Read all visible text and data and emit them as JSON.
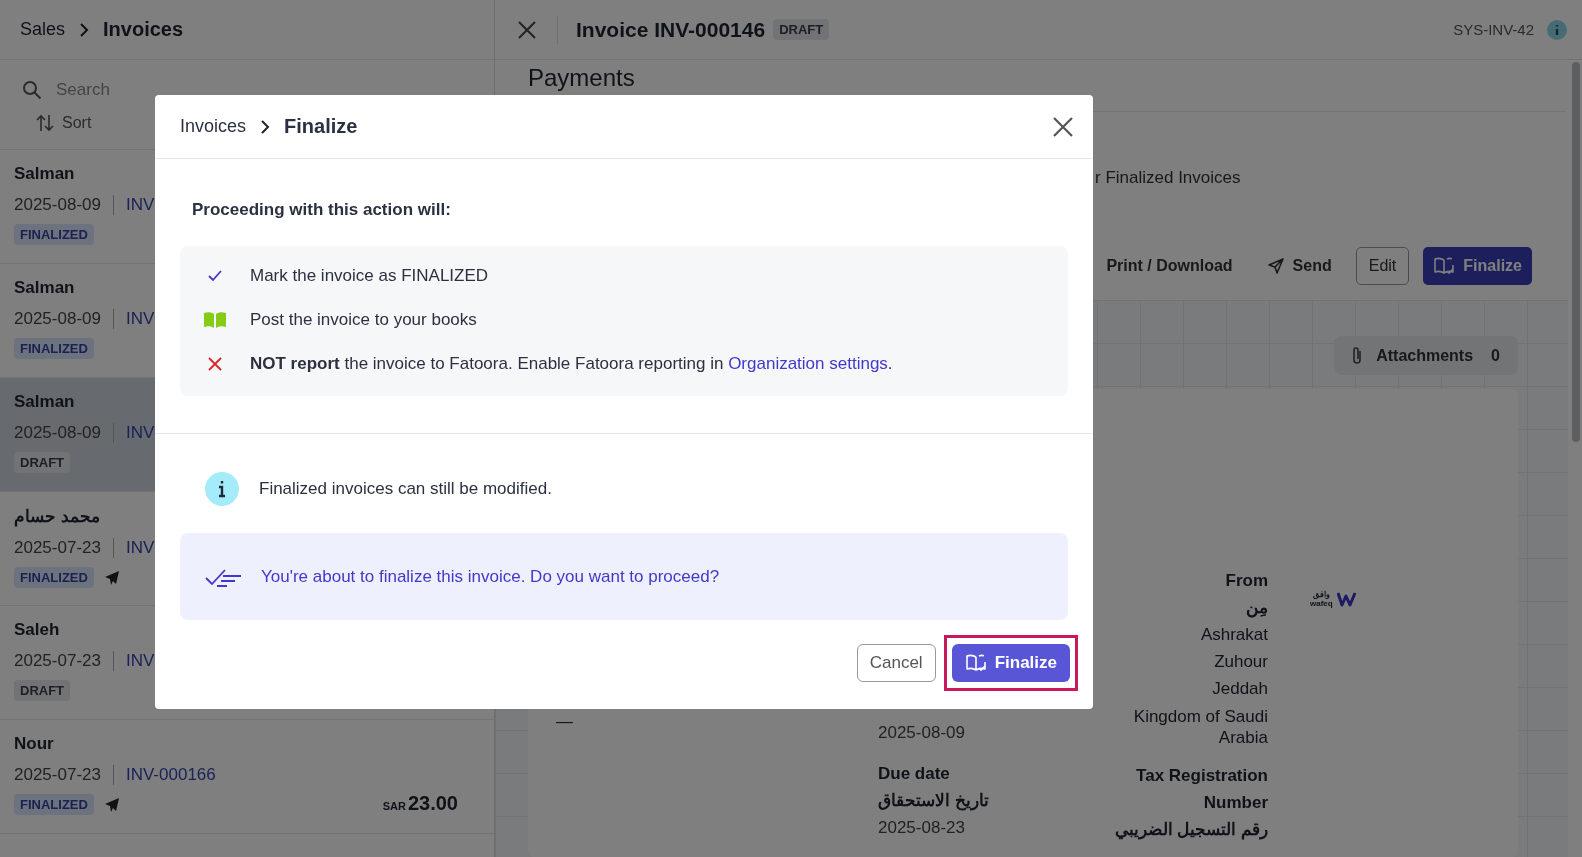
{
  "sidebar": {
    "breadcrumb": [
      "Sales",
      "Invoices"
    ],
    "search": {
      "placeholder": "Search"
    },
    "sort_label": "Sort",
    "invoices": [
      {
        "customer": "Salman",
        "date": "2025-08-09",
        "number": "INV",
        "status": "FINALIZED",
        "kind": "finalized",
        "sent": false,
        "selected": false
      },
      {
        "customer": "Salman",
        "date": "2025-08-09",
        "number": "INV",
        "status": "FINALIZED",
        "kind": "finalized",
        "sent": false,
        "selected": false
      },
      {
        "customer": "Salman",
        "date": "2025-08-09",
        "number": "INV",
        "status": "DRAFT",
        "kind": "draft",
        "sent": false,
        "selected": true
      },
      {
        "customer": "محمد حسام",
        "date": "2025-07-23",
        "number": "INV",
        "status": "FINALIZED",
        "kind": "finalized",
        "sent": true,
        "selected": false
      },
      {
        "customer": "Saleh",
        "date": "2025-07-23",
        "number": "INV",
        "status": "DRAFT",
        "kind": "draft",
        "sent": false,
        "selected": false
      },
      {
        "customer": "Nour",
        "date": "2025-07-23",
        "number": "INV-000166",
        "status": "FINALIZED",
        "kind": "finalized",
        "sent": true,
        "selected": false,
        "currency": "SAR",
        "amount": "23.00"
      }
    ]
  },
  "detail": {
    "title": "Invoice INV-000146",
    "status": {
      "label": "DRAFT",
      "kind": "draft"
    },
    "system_id": "SYS-INV-42",
    "section": "Payments",
    "note": "r Finalized Invoices",
    "actions": [
      {
        "kind": "print",
        "label": "Print / Download"
      },
      {
        "kind": "send",
        "label": "Send"
      },
      {
        "kind": "edit",
        "label": "Edit"
      },
      {
        "kind": "finalize",
        "label": "Finalize"
      }
    ],
    "attachments": {
      "label": "Attachments",
      "count": "0"
    },
    "document": {
      "dash": "—",
      "issue_date": "2025-08-09",
      "due_label": "Due date",
      "due_label_ar": "تاريخ الاستحقاق",
      "due_date": "2025-08-23",
      "from_label": "From",
      "from_label_ar": "مِن",
      "address": [
        "Ashrakat",
        "Zuhour",
        "Jeddah",
        "Kingdom of Saudi Arabia"
      ],
      "tax_label": "Tax Registration Number",
      "tax_label_ar": "رقم التسجيل الضريبي",
      "logo_text": "wafeq",
      "logo_text_ar": "وافق"
    }
  },
  "dialog": {
    "breadcrumb": [
      "Invoices",
      "Finalize"
    ],
    "intro": "Proceeding with this action will:",
    "effects": [
      {
        "kind": "check",
        "text": "Mark the invoice as FINALIZED"
      },
      {
        "kind": "book",
        "text": "Post the invoice to your books"
      },
      {
        "kind": "cross",
        "text": "**NOT report** the invoice to Fatoora. Enable Fatoora reporting in ",
        "link": "Organization settings",
        "after": "."
      }
    ],
    "info": "Finalized invoices can still be modified.",
    "prompt": "You're about to finalize this invoice. Do you want to proceed?",
    "buttons": [
      {
        "kind": "cancel",
        "label": "Cancel",
        "highlighted": false
      },
      {
        "kind": "finalize",
        "label": "Finalize",
        "highlighted": true
      }
    ]
  }
}
